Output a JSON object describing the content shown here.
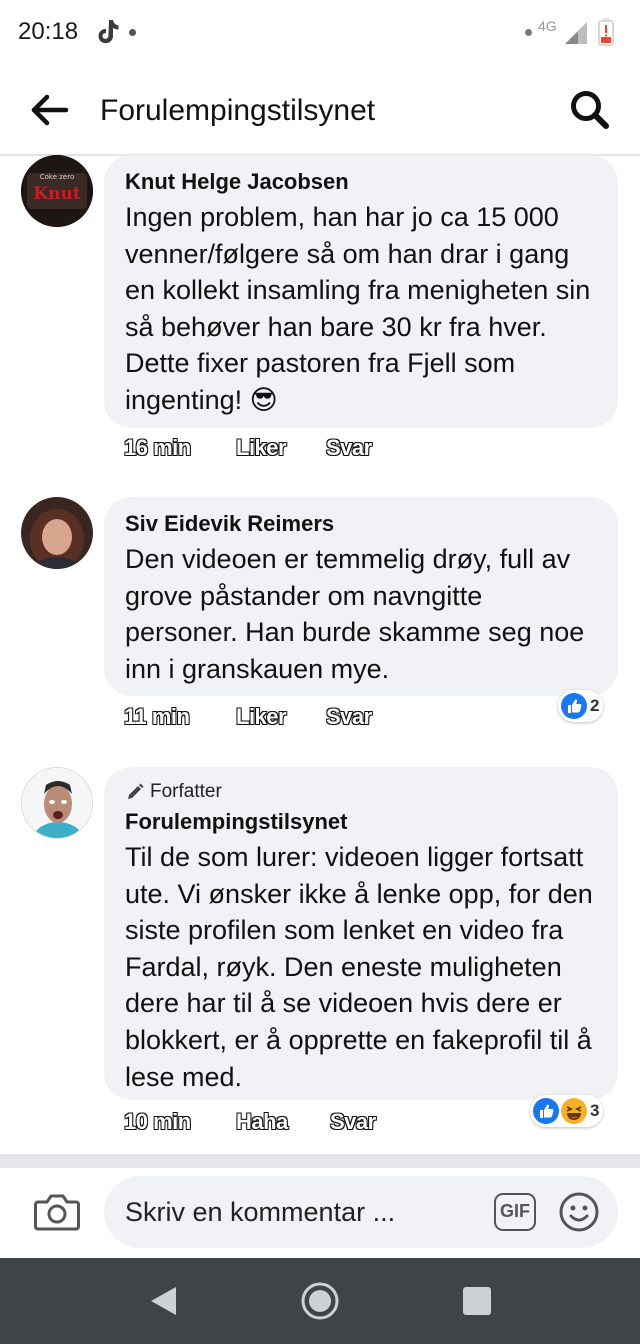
{
  "status_bar": {
    "time": "20:18",
    "network": "4G",
    "icons": [
      "tiktok-icon",
      "notification-dot-icon",
      "signal-icon",
      "battery-low-icon"
    ]
  },
  "header": {
    "title": "Forulempingstilsynet",
    "back_icon": "arrow-left-icon",
    "search_icon": "search-icon"
  },
  "comments": [
    {
      "author": "Knut Helge Jacobsen",
      "avatar_label": "Knut",
      "text": "Ingen problem, han har jo ca 15 000 venner/følgere så om han drar i gang en kollekt insamling fra menigheten sin så behøver han bare 30 kr fra hver. Dette fixer pastoren fra Fjell som ingenting! 😎",
      "time": "16 min",
      "like_label": "Liker",
      "reply_label": "Svar"
    },
    {
      "author": "Siv Eidevik Reimers",
      "text": "Den videoen er temmelig drøy, full av grove påstander om navngitte personer. Han burde skamme seg noe inn i granskauen mye.",
      "time": "11 min",
      "like_label": "Liker",
      "reply_label": "Svar",
      "reaction_count": "2",
      "reactions": [
        "like-icon"
      ]
    },
    {
      "badge": "Forfatter",
      "author": "Forulempingstilsynet",
      "text": "Til de som lurer: videoen ligger fortsatt ute. Vi ønsker ikke å lenke opp, for den siste profilen som lenket en video fra Fardal, røyk. Den eneste muligheten dere har til å se videoen hvis dere er blokkert, er å opprette en fakeprofil til å lese med.",
      "time": "10 min",
      "like_label": "Haha",
      "reply_label": "Svar",
      "reaction_count": "3",
      "reactions": [
        "like-icon",
        "haha-icon"
      ]
    }
  ],
  "composer": {
    "placeholder": "Skriv en kommentar ...",
    "gif_label": "GIF",
    "camera_icon": "camera-icon",
    "emoji_icon": "emoji-icon"
  },
  "nav_bar": {
    "icons": [
      "nav-back-icon",
      "nav-home-icon",
      "nav-recents-icon"
    ]
  },
  "colors": {
    "bubble": "#f0f2f5",
    "like_blue": "#1877f2",
    "nav_bar": "#3f4448",
    "haha_yellow": "#f7b125"
  }
}
